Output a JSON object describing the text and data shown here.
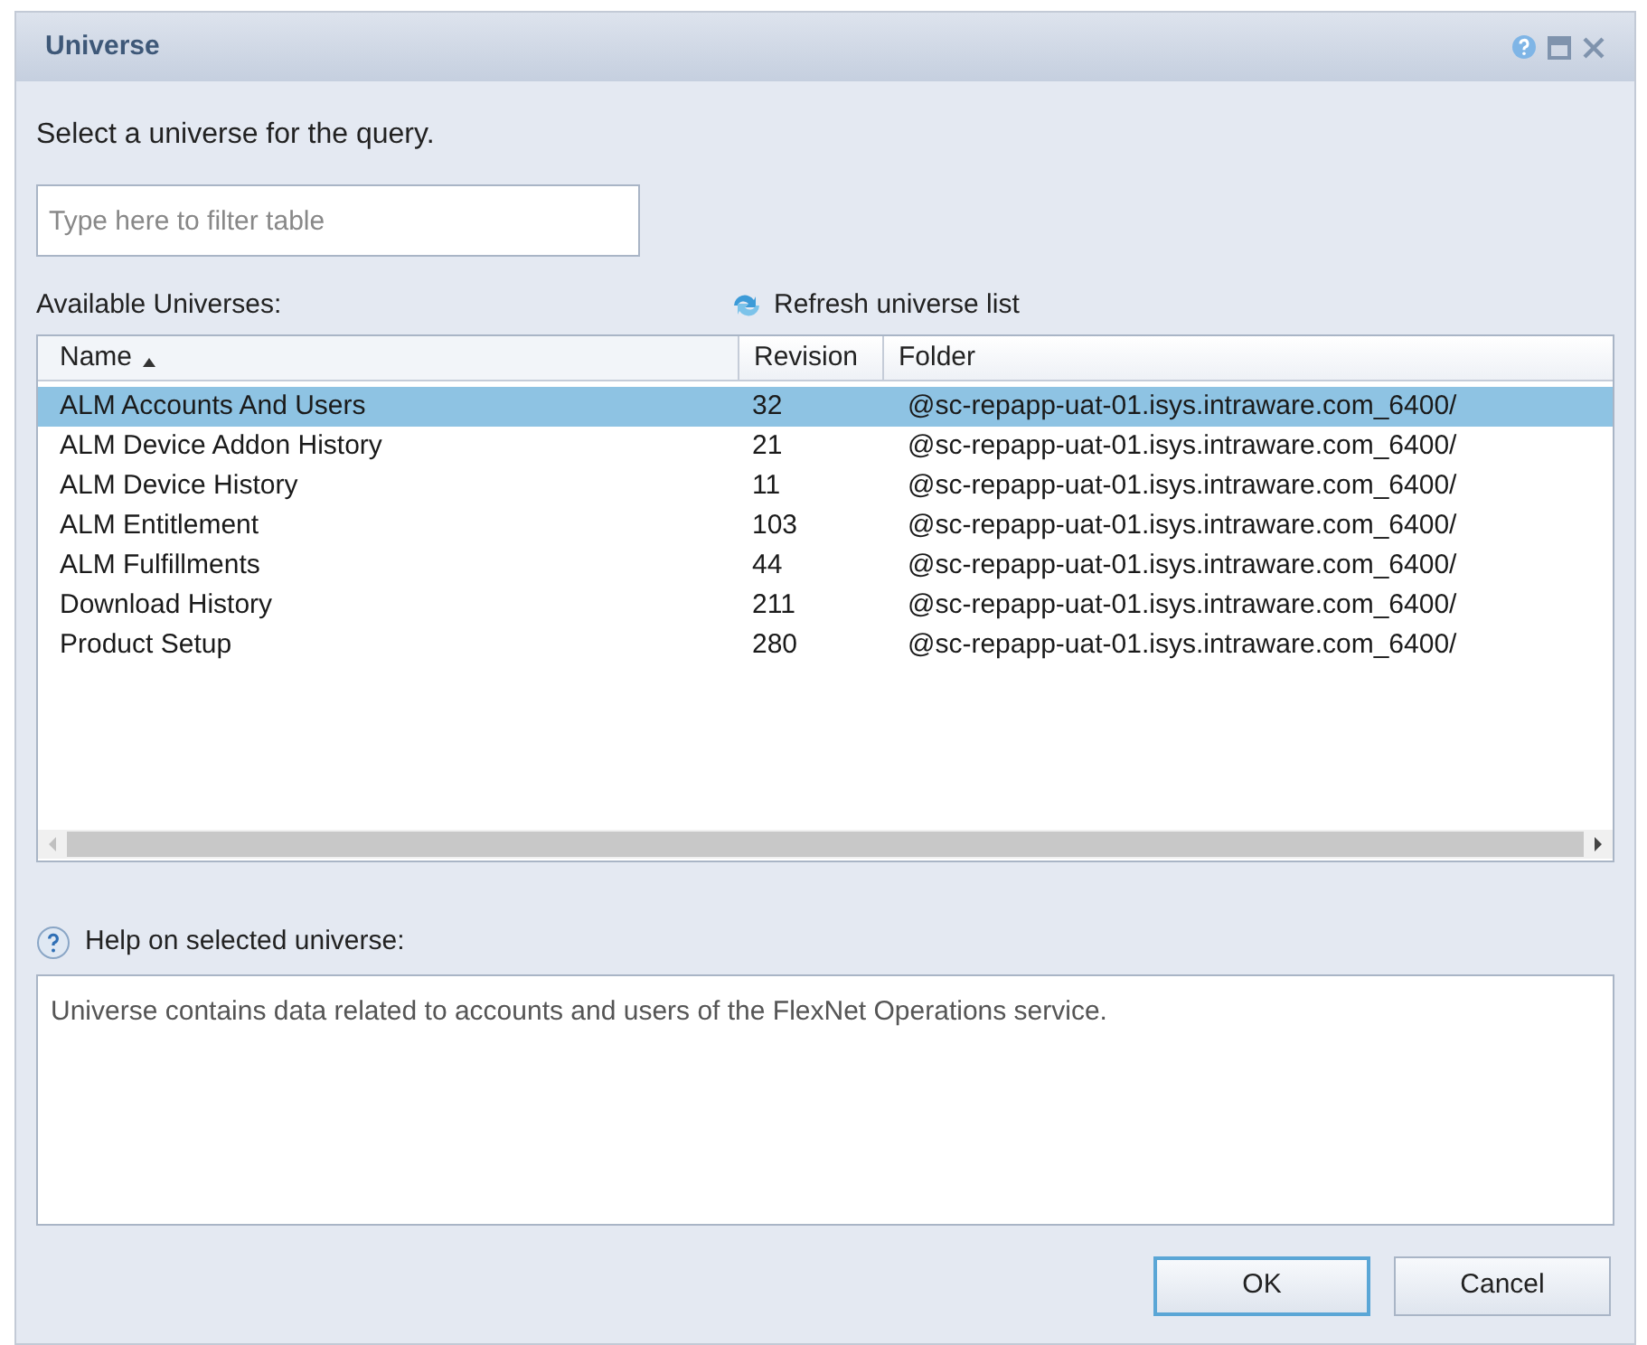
{
  "window": {
    "title": "Universe"
  },
  "instruction": "Select a universe for the query.",
  "filter": {
    "placeholder": "Type here to filter table"
  },
  "available_label": "Available Universes:",
  "refresh_link": "Refresh universe list",
  "table": {
    "columns": [
      {
        "label": "Name",
        "sorted": true
      },
      {
        "label": "Revision",
        "sorted": false
      },
      {
        "label": "Folder",
        "sorted": false
      }
    ],
    "rows": [
      {
        "name": "ALM Accounts And Users",
        "revision": "32",
        "folder": "@sc-repapp-uat-01.isys.intraware.com_6400/",
        "selected": true
      },
      {
        "name": "ALM Device Addon History",
        "revision": "21",
        "folder": "@sc-repapp-uat-01.isys.intraware.com_6400/",
        "selected": false
      },
      {
        "name": "ALM Device History",
        "revision": "11",
        "folder": "@sc-repapp-uat-01.isys.intraware.com_6400/",
        "selected": false
      },
      {
        "name": "ALM Entitlement",
        "revision": "103",
        "folder": "@sc-repapp-uat-01.isys.intraware.com_6400/",
        "selected": false
      },
      {
        "name": "ALM Fulfillments",
        "revision": "44",
        "folder": "@sc-repapp-uat-01.isys.intraware.com_6400/",
        "selected": false
      },
      {
        "name": "Download History",
        "revision": "211",
        "folder": "@sc-repapp-uat-01.isys.intraware.com_6400/",
        "selected": false
      },
      {
        "name": "Product Setup",
        "revision": "280",
        "folder": "@sc-repapp-uat-01.isys.intraware.com_6400/",
        "selected": false
      }
    ]
  },
  "help": {
    "label": "Help on selected universe:",
    "text": "Universe contains data related to accounts and users of the FlexNet Operations service."
  },
  "buttons": [
    {
      "label": "OK",
      "default": true
    },
    {
      "label": "Cancel",
      "default": false
    }
  ]
}
